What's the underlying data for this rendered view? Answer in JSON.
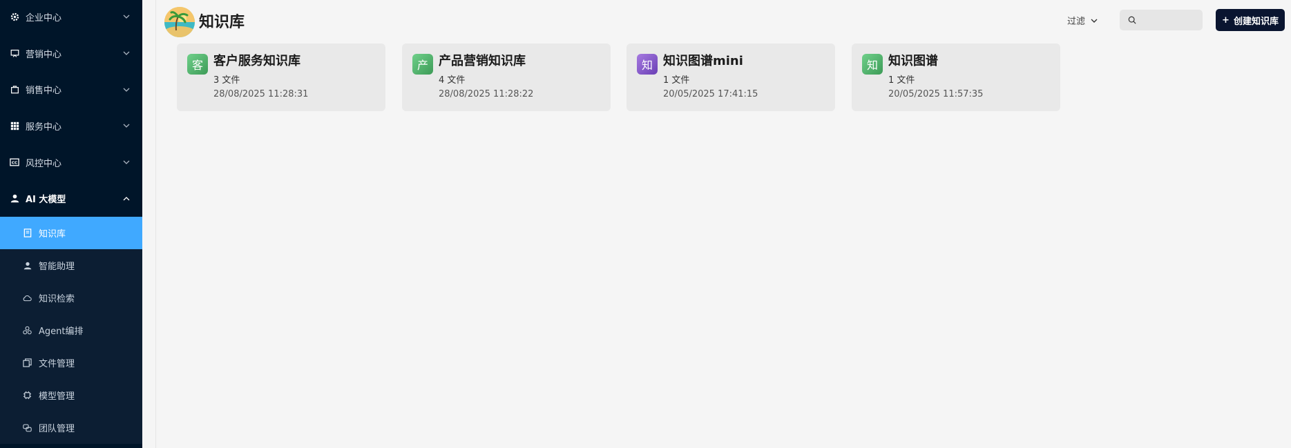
{
  "sidebar": {
    "groups": [
      {
        "label": "企业中心",
        "icon": "gear-icon"
      },
      {
        "label": "营销中心",
        "icon": "presentation-icon"
      },
      {
        "label": "销售中心",
        "icon": "bag-icon"
      },
      {
        "label": "服务中心",
        "icon": "grid-icon"
      },
      {
        "label": "风控中心",
        "icon": "cc-icon"
      },
      {
        "label": "AI 大模型",
        "icon": "user-icon"
      }
    ],
    "ai_items": [
      {
        "label": "知识库",
        "icon": "book-icon"
      },
      {
        "label": "智能助理",
        "icon": "person-icon"
      },
      {
        "label": "知识检索",
        "icon": "cloud-icon"
      },
      {
        "label": "Agent编排",
        "icon": "nodes-icon"
      },
      {
        "label": "文件管理",
        "icon": "files-icon"
      },
      {
        "label": "模型管理",
        "icon": "chip-icon"
      },
      {
        "label": "团队管理",
        "icon": "team-icon"
      }
    ]
  },
  "header": {
    "title": "知识库",
    "filter_label": "过滤",
    "search_placeholder": "",
    "create_label": "创建知识库"
  },
  "cards": [
    {
      "badge": "客",
      "title": "客户服务知识库",
      "count": "3 文件",
      "date": "28/08/2025 11:28:31",
      "color": "#4caf6b"
    },
    {
      "badge": "产",
      "title": "产品营销知识库",
      "count": "4 文件",
      "date": "28/08/2025 11:28:22",
      "color": "#4caf6b"
    },
    {
      "badge": "知",
      "title": "知识图谱mini",
      "count": "1 文件",
      "date": "20/05/2025 17:41:15",
      "color": "#7e57c2"
    },
    {
      "badge": "知",
      "title": "知识图谱",
      "count": "1 文件",
      "date": "20/05/2025 11:57:35",
      "color": "#4caf6b"
    }
  ],
  "colors": {
    "sidebar_bg": "#001529",
    "active_item": "#40a9ff",
    "primary_button": "#0a1530"
  }
}
